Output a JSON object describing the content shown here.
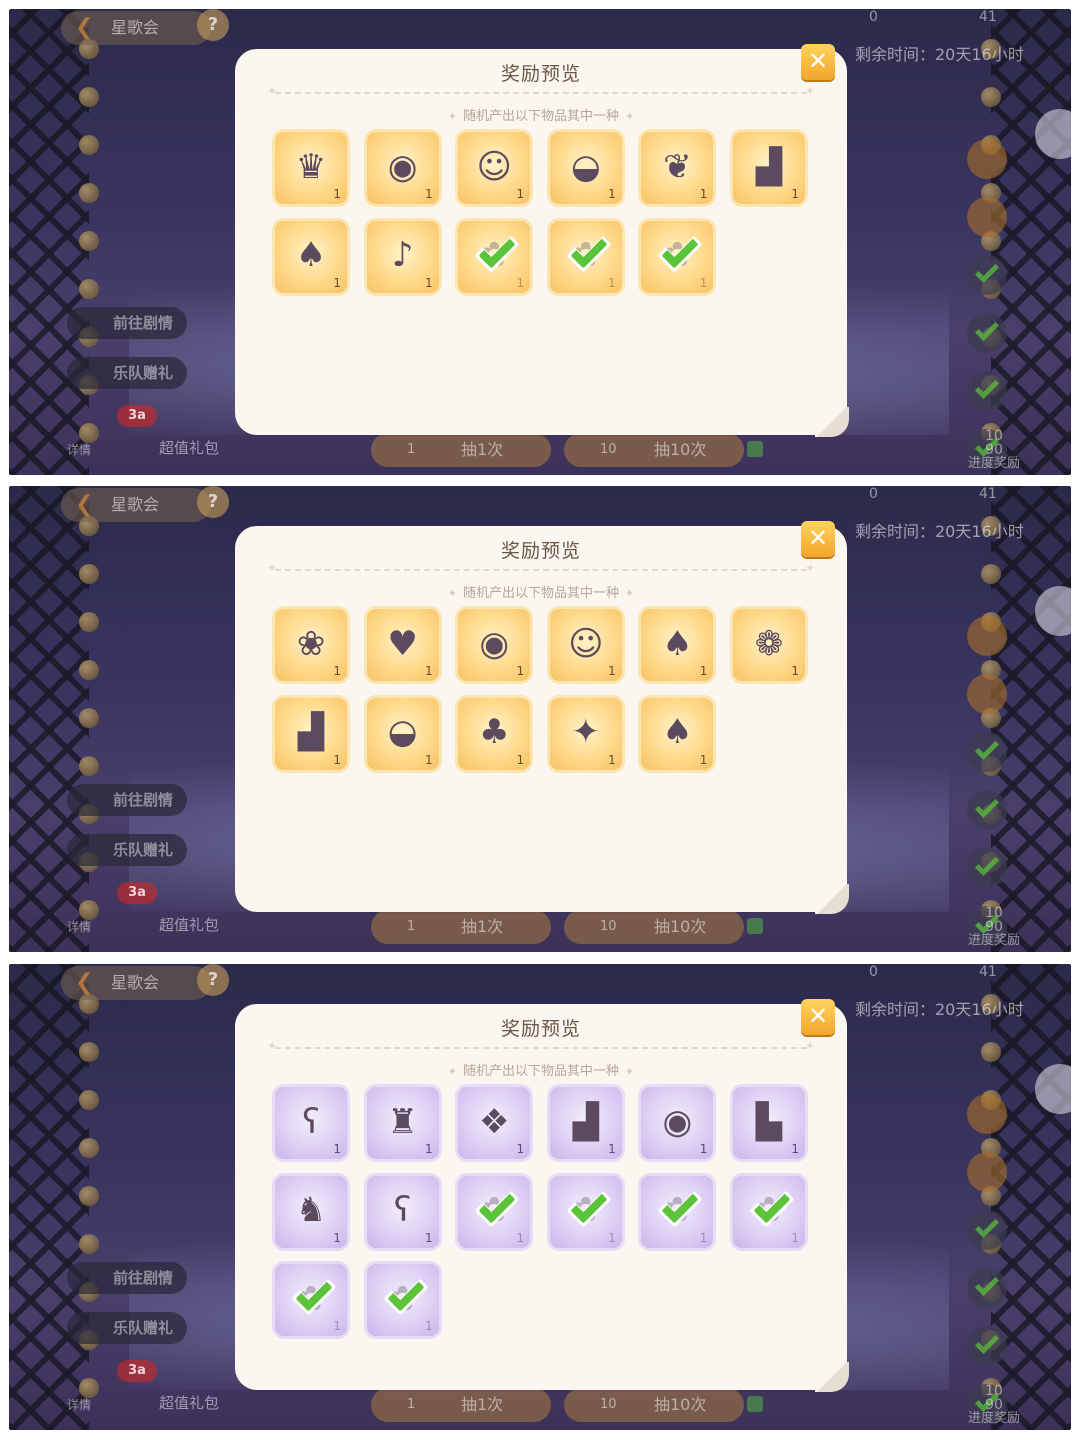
{
  "background": {
    "back_label": "星歌会",
    "help_label": "?",
    "stat_left": "0",
    "stat_right": "41",
    "timer": "剩余时间：20天16小时",
    "story_button": "前往剧情",
    "band_gift_button": "乐队赠礼",
    "badge": "3a",
    "detail_label": "详情",
    "value_pack_label": "超值礼包",
    "draw_one_count": "1",
    "draw_one_label": "抽1次",
    "draw_ten_count": "10",
    "draw_ten_label": "抽10次",
    "progress_num_top": "10",
    "progress_num": "90",
    "progress_label": "进度奖励"
  },
  "panels": [
    {
      "title": "奖励预览",
      "subtitle": "随机产出以下物品其中一种",
      "close_label": "✕",
      "theme": "gold",
      "items": [
        {
          "icon": "kuromi-hood-icon",
          "glyph": "♛",
          "qty": "1",
          "owned": false
        },
        {
          "icon": "eyes-icon",
          "glyph": "◉",
          "qty": "1",
          "owned": false
        },
        {
          "icon": "yellow-pillow-icon",
          "glyph": "☺",
          "qty": "1",
          "owned": false
        },
        {
          "icon": "yellow-hat-icon",
          "glyph": "◒",
          "qty": "1",
          "owned": false
        },
        {
          "icon": "egg-accessory-icon",
          "glyph": "❦",
          "qty": "1",
          "owned": false
        },
        {
          "icon": "boots-icon",
          "glyph": "▟",
          "qty": "1",
          "owned": false
        },
        {
          "icon": "hoodie-icon",
          "glyph": "♠",
          "qty": "1",
          "owned": false
        },
        {
          "icon": "guitar-icon",
          "glyph": "♪",
          "qty": "1",
          "owned": false
        },
        {
          "icon": "outfit-icon",
          "glyph": "✿",
          "qty": "1",
          "owned": true
        },
        {
          "icon": "outfit-icon",
          "glyph": "✿",
          "qty": "1",
          "owned": true
        },
        {
          "icon": "outfit-icon",
          "glyph": "✿",
          "qty": "1",
          "owned": true
        }
      ]
    },
    {
      "title": "奖励预览",
      "subtitle": "随机产出以下物品其中一种",
      "close_label": "✕",
      "theme": "gold",
      "items": [
        {
          "icon": "melody-hood-icon",
          "glyph": "❀",
          "qty": "1",
          "owned": false
        },
        {
          "icon": "pink-hair-icon",
          "glyph": "♥",
          "qty": "1",
          "owned": false
        },
        {
          "icon": "eyes-icon",
          "glyph": "◉",
          "qty": "1",
          "owned": false
        },
        {
          "icon": "yellow-pillow-icon",
          "glyph": "☺",
          "qty": "1",
          "owned": false
        },
        {
          "icon": "jacket-icon",
          "glyph": "♠",
          "qty": "1",
          "owned": false
        },
        {
          "icon": "pink-dress-icon",
          "glyph": "❁",
          "qty": "1",
          "owned": false
        },
        {
          "icon": "sneakers-icon",
          "glyph": "▟",
          "qty": "1",
          "owned": false
        },
        {
          "icon": "yellow-hat-icon",
          "glyph": "◒",
          "qty": "1",
          "owned": false
        },
        {
          "icon": "sweater-icon",
          "glyph": "♣",
          "qty": "1",
          "owned": false
        },
        {
          "icon": "pose-icon",
          "glyph": "✦",
          "qty": "1",
          "owned": false
        },
        {
          "icon": "coat-icon",
          "glyph": "♠",
          "qty": "1",
          "owned": false
        }
      ]
    },
    {
      "title": "奖励预览",
      "subtitle": "随机产出以下物品其中一种",
      "close_label": "✕",
      "theme": "purple",
      "items": [
        {
          "icon": "bear-hood-icon",
          "glyph": "ʕ",
          "qty": "1",
          "owned": false
        },
        {
          "icon": "black-outfit-icon",
          "glyph": "♜",
          "qty": "1",
          "owned": false
        },
        {
          "icon": "necklace-icon",
          "glyph": "❖",
          "qty": "1",
          "owned": false
        },
        {
          "icon": "black-boots-icon",
          "glyph": "▟",
          "qty": "1",
          "owned": false
        },
        {
          "icon": "eyes-icon",
          "glyph": "◉",
          "qty": "1",
          "owned": false
        },
        {
          "icon": "platform-boots-icon",
          "glyph": "▙",
          "qty": "1",
          "owned": false
        },
        {
          "icon": "plaid-jacket-icon",
          "glyph": "♞",
          "qty": "1",
          "owned": false
        },
        {
          "icon": "bear-hood-icon",
          "glyph": "ʕ",
          "qty": "1",
          "owned": false
        },
        {
          "icon": "outfit-icon",
          "glyph": "✿",
          "qty": "1",
          "owned": true
        },
        {
          "icon": "outfit-icon",
          "glyph": "✿",
          "qty": "1",
          "owned": true
        },
        {
          "icon": "outfit-icon",
          "glyph": "✿",
          "qty": "1",
          "owned": true
        },
        {
          "icon": "outfit-icon",
          "glyph": "✿",
          "qty": "1",
          "owned": true
        },
        {
          "icon": "outfit-icon",
          "glyph": "✿",
          "qty": "1",
          "owned": true
        },
        {
          "icon": "outfit-icon",
          "glyph": "✿",
          "qty": "1",
          "owned": true
        }
      ]
    }
  ]
}
